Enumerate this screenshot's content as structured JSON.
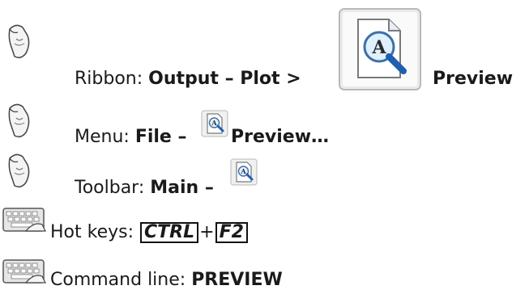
{
  "ribbon": {
    "prefix": "Ribbon: ",
    "path": "Output – Plot >",
    "command": "Preview",
    "icon": "preview-icon"
  },
  "menu": {
    "prefix": "Menu: ",
    "path": "File –",
    "command": "Preview…",
    "icon": "preview-icon"
  },
  "toolbar": {
    "prefix": "Toolbar: ",
    "path": "Main –",
    "icon": "preview-icon"
  },
  "hotkeys": {
    "prefix": "Hot keys: ",
    "key1": "CTRL",
    "plus": "+",
    "key2": "F2"
  },
  "command_line": {
    "prefix": "Command line: ",
    "command": "PREVIEW"
  },
  "icons": {
    "mouse": "mouse-hand-icon",
    "keyboard": "keyboard-hand-icon"
  }
}
